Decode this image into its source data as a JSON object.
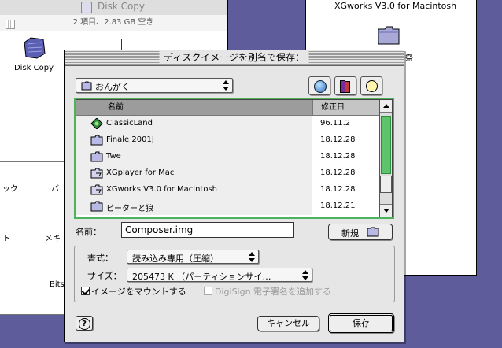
{
  "background_windows": {
    "disk_copy": {
      "title": "Disk Copy",
      "info": "2 項目、2.83 GB 空き",
      "icon_label": "Disk Copy"
    },
    "xgworks_window": {
      "title": "XGworks V3.0 for Macintosh"
    },
    "fragments": [
      "ック",
      "バ",
      "ト",
      "メキ",
      "Bits"
    ]
  },
  "dialog": {
    "title": "ディスクイメージを別名で保存：",
    "location_popup": "おんがく",
    "columns": {
      "name": "名前",
      "date": "修正日"
    },
    "files": [
      {
        "name": "ClassicLand",
        "date": "96.11.2",
        "icon": "app-icon"
      },
      {
        "name": "Finale 2001J",
        "date": "18.12.28",
        "icon": "folder-icon"
      },
      {
        "name": "Twe",
        "date": "18.12.28",
        "icon": "folder-icon"
      },
      {
        "name": "XGplayer for Mac",
        "date": "18.12.28",
        "icon": "alias-folder-icon"
      },
      {
        "name": "XGworks V3.0 for Macintosh",
        "date": "18.12.28",
        "icon": "alias-folder-icon"
      },
      {
        "name": "ピーターと狼",
        "date": "18.12.21",
        "icon": "folder-icon"
      }
    ],
    "name_label": "名前：",
    "name_value": "Composer.img",
    "new_button": "新規",
    "format_label": "書式：",
    "format_value": "読み込み専用（圧縮）",
    "size_label": "サイズ：",
    "size_value": "205473 K （パーティションサイ…",
    "mount_checkbox": {
      "label": "イメージをマウントする",
      "checked": true
    },
    "sign_checkbox": {
      "label": "DigiSign 電子署名を追加する",
      "checked": false,
      "enabled": false
    },
    "help_button": "?",
    "cancel_button": "キャンセル",
    "save_button": "保存",
    "accent_color": "#4cb35c"
  }
}
